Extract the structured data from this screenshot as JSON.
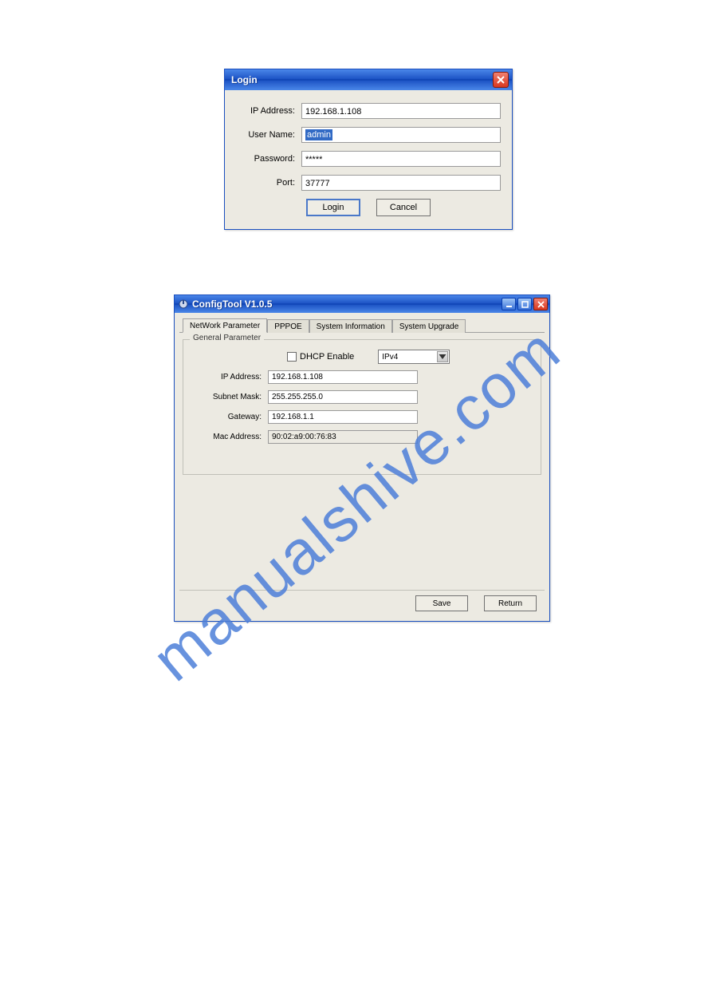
{
  "watermark": "manualshive.com",
  "login": {
    "title": "Login",
    "fields": {
      "ip_label": "IP Address:",
      "ip_value": "192.168.1.108",
      "user_label": "User Name:",
      "user_value": "admin",
      "pass_label": "Password:",
      "pass_value": "*****",
      "port_label": "Port:",
      "port_value": "37777"
    },
    "buttons": {
      "login": "Login",
      "cancel": "Cancel"
    }
  },
  "config": {
    "title": "ConfigTool V1.0.5",
    "tabs": [
      "NetWork Parameter",
      "PPPOE",
      "System Information",
      "System Upgrade"
    ],
    "active_tab": 0,
    "fieldset_legend": "General Parameter",
    "dhcp_label": "DHCP Enable",
    "dhcp_checked": false,
    "ip_version_selected": "IPv4",
    "fields": {
      "ip_label": "IP Address:",
      "ip_value": "192.168.1.108",
      "subnet_label": "Subnet Mask:",
      "subnet_value": "255.255.255.0",
      "gateway_label": "Gateway:",
      "gateway_value": "192.168.1.1",
      "mac_label": "Mac Address:",
      "mac_value": "90:02:a9:00:76:83"
    },
    "buttons": {
      "save": "Save",
      "return": "Return"
    }
  }
}
